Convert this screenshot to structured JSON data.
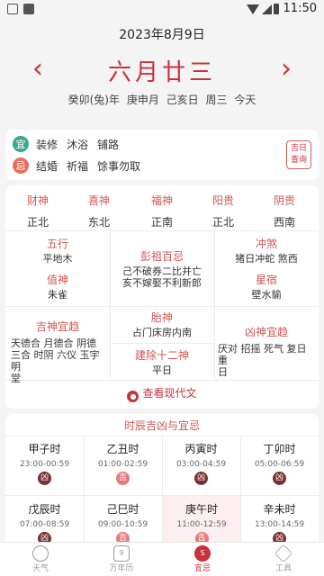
{
  "statusbar": {
    "time": "11:50"
  },
  "header": {
    "solar_date": "2023年8月9日",
    "lunar_day": "六月廿三",
    "prev": "‹",
    "next": "›",
    "ganzhi": [
      "癸卯(兔)年",
      "庚申月",
      "己亥日",
      "周三",
      "今天"
    ]
  },
  "yiji": {
    "yi_badge": "宜",
    "yi_items": [
      "装修",
      "沐浴",
      "铺路"
    ],
    "ji_badge": "忌",
    "ji_items": [
      "结婚",
      "祈福",
      "馀事勿取"
    ],
    "jiri_line1": "吉日",
    "jiri_line2": "查询",
    "yi_color": "#3aa88a",
    "ji_color": "#e8705f"
  },
  "gods": [
    {
      "name": "财神",
      "dir": "正北"
    },
    {
      "name": "喜神",
      "dir": "东北"
    },
    {
      "name": "福神",
      "dir": "正南"
    },
    {
      "name": "阳贵",
      "dir": "正北"
    },
    {
      "name": "阴贵",
      "dir": "西南"
    }
  ],
  "grid": {
    "wuxing": {
      "title": "五行",
      "value": "平地木"
    },
    "pengzu": {
      "title": "彭祖百忌",
      "value1": "己不破券二比并亡",
      "value2": "亥不嫁娶不利新郎"
    },
    "chongsha": {
      "title": "冲煞",
      "value": "猪日冲蛇 煞西"
    },
    "zhishen": {
      "title": "值神",
      "value": "朱雀"
    },
    "xingsu": {
      "title": "星宿",
      "value": "壁水貐"
    },
    "jishen": {
      "title": "吉神宜趋",
      "value1": "天德合 月德合 阴德",
      "value2": "三合 时阴 六仪 玉宇 明",
      "value3": "堂"
    },
    "taishen": {
      "title": "胎神",
      "value": "占门床房内南"
    },
    "jianchu": {
      "title": "建除十二神",
      "value": "平日"
    },
    "xiongshen": {
      "title": "凶神宜趋",
      "value1": "厌对 招摇 死气 复日 重",
      "value2": "日"
    },
    "modern_link": "查看现代文"
  },
  "hours": {
    "title": "时辰吉凶与宜忌",
    "items": [
      {
        "name": "甲子时",
        "time": "23:00-00:59",
        "luck": "凶"
      },
      {
        "name": "乙丑时",
        "time": "01:00-02:59",
        "luck": "吉"
      },
      {
        "name": "丙寅时",
        "time": "03:00-04:59",
        "luck": "凶"
      },
      {
        "name": "丁卯时",
        "time": "05:00-06:59",
        "luck": "凶"
      },
      {
        "name": "戊辰时",
        "time": "07:00-08:59",
        "luck": "凶"
      },
      {
        "name": "己巳时",
        "time": "09:00-10:59",
        "luck": "吉"
      },
      {
        "name": "庚午时",
        "time": "11:00-12:59",
        "luck": "吉"
      },
      {
        "name": "辛未时",
        "time": "13:00-14:59",
        "luck": "凶"
      }
    ]
  },
  "tabs": [
    {
      "label": "天气",
      "icon": "cloud-icon"
    },
    {
      "label": "万年历",
      "icon": "calendar-icon",
      "glyph": "9"
    },
    {
      "label": "宜忌",
      "icon": "yiji-icon",
      "glyph": "S"
    },
    {
      "label": "工具",
      "icon": "box-icon"
    }
  ]
}
